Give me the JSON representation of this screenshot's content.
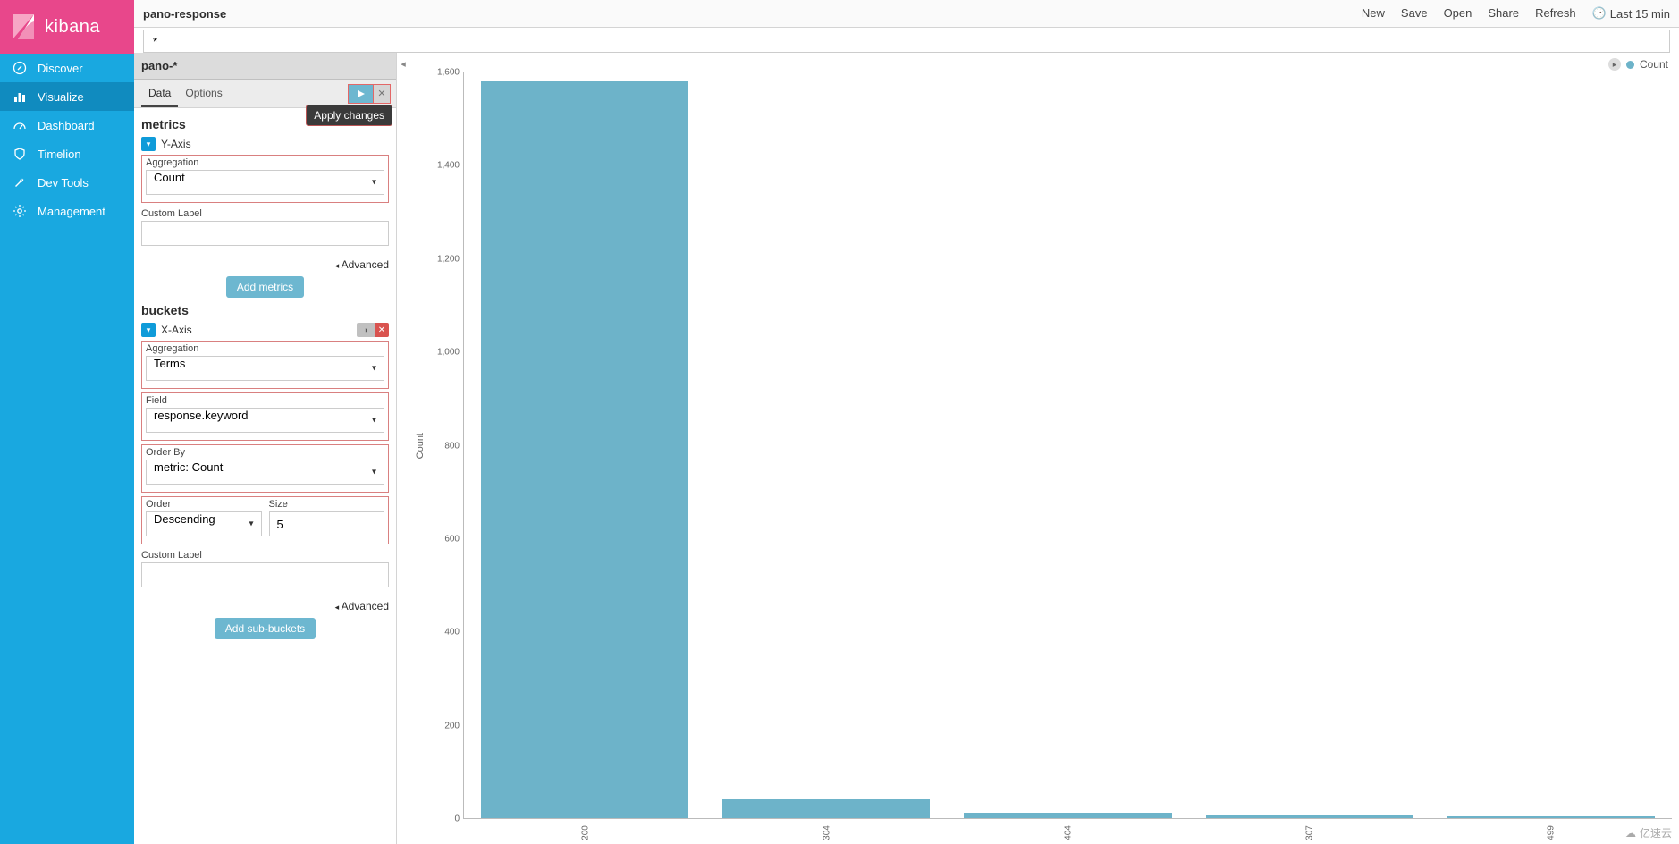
{
  "brand": "kibana",
  "nav": [
    {
      "label": "Discover",
      "icon": "compass"
    },
    {
      "label": "Visualize",
      "icon": "barchart",
      "active": true
    },
    {
      "label": "Dashboard",
      "icon": "gauge"
    },
    {
      "label": "Timelion",
      "icon": "shield"
    },
    {
      "label": "Dev Tools",
      "icon": "wrench"
    },
    {
      "label": "Management",
      "icon": "gear"
    }
  ],
  "topbar": {
    "title": "pano-response",
    "actions": [
      "New",
      "Save",
      "Open",
      "Share",
      "Refresh"
    ],
    "time_label": "Last 15 min"
  },
  "search": {
    "value": "*"
  },
  "index_pattern": "pano-*",
  "tabs": {
    "data": "Data",
    "options": "Options"
  },
  "apply_tooltip": "Apply changes",
  "metrics": {
    "title": "metrics",
    "yaxis_label": "Y-Axis",
    "agg_label": "Aggregation",
    "agg_value": "Count",
    "custom_label": "Custom Label",
    "custom_value": "",
    "advanced": "Advanced",
    "add_btn": "Add metrics"
  },
  "buckets": {
    "title": "buckets",
    "xaxis_label": "X-Axis",
    "agg_label": "Aggregation",
    "agg_value": "Terms",
    "field_label": "Field",
    "field_value": "response.keyword",
    "orderby_label": "Order By",
    "orderby_value": "metric: Count",
    "order_label": "Order",
    "order_value": "Descending",
    "size_label": "Size",
    "size_value": "5",
    "custom_label": "Custom Label",
    "custom_value": "",
    "advanced": "Advanced",
    "add_btn": "Add sub-buckets"
  },
  "legend": {
    "series": "Count"
  },
  "chart_data": {
    "type": "bar",
    "categories": [
      "200",
      "304",
      "404",
      "307",
      "499"
    ],
    "values": [
      1580,
      40,
      12,
      5,
      3
    ],
    "ylabel": "Count",
    "xlabel": "",
    "ylim": [
      0,
      1600
    ],
    "yticks": [
      0,
      200,
      400,
      600,
      800,
      1000,
      1200,
      1400,
      1600
    ],
    "series_color": "#6db3c9"
  },
  "watermark": "亿速云"
}
